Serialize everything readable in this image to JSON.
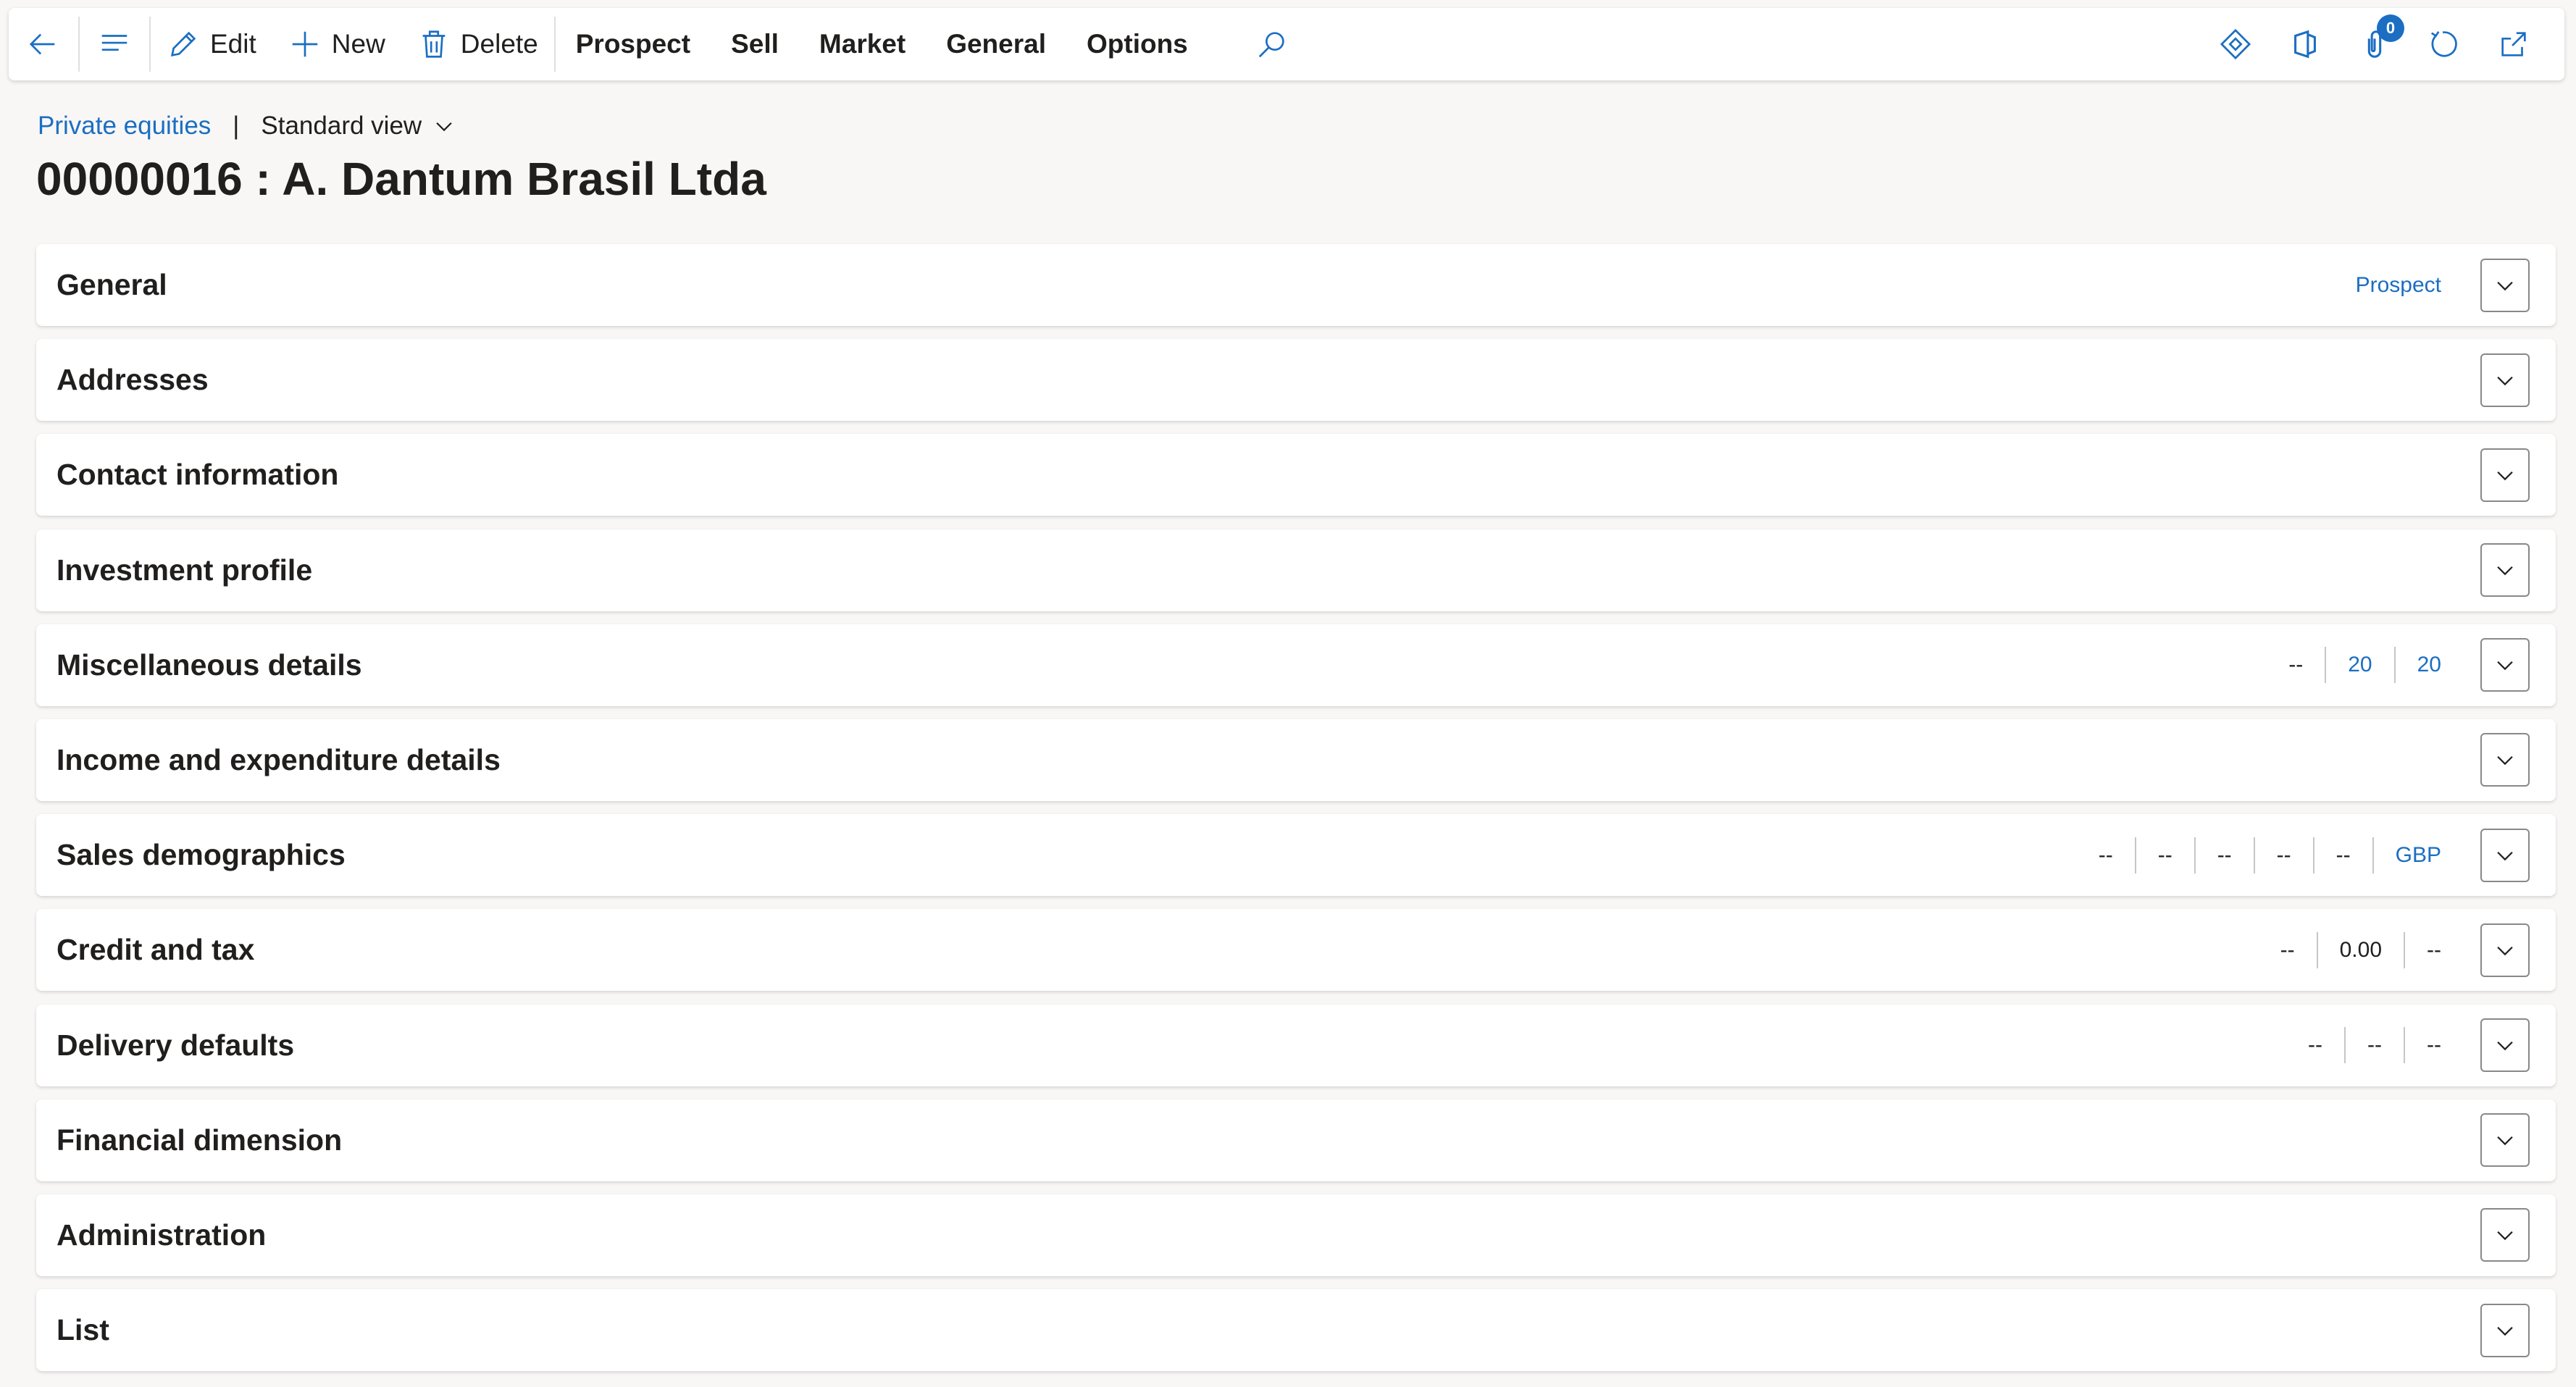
{
  "action_pane": {
    "edit_label": "Edit",
    "new_label": "New",
    "delete_label": "Delete",
    "tabs": [
      "Prospect",
      "Sell",
      "Market",
      "General",
      "Options"
    ],
    "attachments_count": "0"
  },
  "breadcrumb": {
    "link": "Private equities",
    "divider": "|",
    "view": "Standard view"
  },
  "page_title": "00000016 : A. Dantum Brasil Ltda",
  "fasttabs": [
    {
      "title": "General",
      "summary": [
        {
          "text": "Prospect",
          "link": true
        }
      ]
    },
    {
      "title": "Addresses",
      "summary": []
    },
    {
      "title": "Contact information",
      "summary": []
    },
    {
      "title": "Investment profile",
      "summary": []
    },
    {
      "title": "Miscellaneous details",
      "summary": [
        {
          "text": "--",
          "link": false
        },
        {
          "text": "20",
          "link": true
        },
        {
          "text": "20",
          "link": true
        }
      ]
    },
    {
      "title": "Income and expenditure details",
      "summary": []
    },
    {
      "title": "Sales demographics",
      "summary": [
        {
          "text": "--",
          "link": false
        },
        {
          "text": "--",
          "link": false
        },
        {
          "text": "--",
          "link": false
        },
        {
          "text": "--",
          "link": false
        },
        {
          "text": "--",
          "link": false
        },
        {
          "text": "GBP",
          "link": true
        }
      ]
    },
    {
      "title": "Credit and tax",
      "summary": [
        {
          "text": "--",
          "link": false
        },
        {
          "text": "0.00",
          "link": false
        },
        {
          "text": "--",
          "link": false
        }
      ]
    },
    {
      "title": "Delivery defaults",
      "summary": [
        {
          "text": "--",
          "link": false
        },
        {
          "text": "--",
          "link": false
        },
        {
          "text": "--",
          "link": false
        }
      ]
    },
    {
      "title": "Financial dimension",
      "summary": []
    },
    {
      "title": "Administration",
      "summary": []
    },
    {
      "title": "List",
      "summary": []
    }
  ],
  "colors": {
    "accent": "#1b6ec2",
    "background": "#f8f7f6",
    "text": "#201f1e"
  }
}
